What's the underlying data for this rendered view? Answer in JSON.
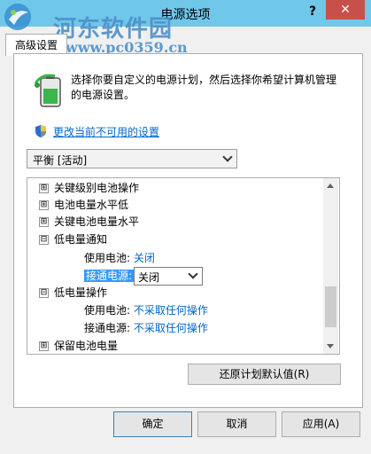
{
  "window": {
    "title": "电源选项",
    "help_label": "?",
    "close_label": "✕"
  },
  "watermark": {
    "title": "河东软件园",
    "url": "www.pc0359.cn"
  },
  "tab": {
    "label": "高级设置"
  },
  "description": "选择你要自定义的电源计划，然后选择你希望计算机管理的电源设置。",
  "change_link": "更改当前不可用的设置",
  "plan_select": {
    "value": "平衡 [活动]"
  },
  "tree": {
    "items": [
      {
        "expander": "⊞",
        "label": "关键级别电池操作"
      },
      {
        "expander": "⊞",
        "label": "电池电量水平低"
      },
      {
        "expander": "⊞",
        "label": "关键电池电量水平"
      },
      {
        "expander": "⊟",
        "label": "低电量通知"
      },
      {
        "label": "使用电池:",
        "value": "关闭"
      },
      {
        "label": "接通电源:",
        "value": "关闭"
      },
      {
        "expander": "⊟",
        "label": "低电量操作"
      },
      {
        "label": "使用电池:",
        "value": "不采取任何操作"
      },
      {
        "label": "接通电源:",
        "value": "不采取任何操作"
      },
      {
        "expander": "⊞",
        "label": "保留电池电量"
      }
    ]
  },
  "buttons": {
    "restore": "还原计划默认值(R)",
    "ok": "确定",
    "cancel": "取消",
    "apply": "应用(A)"
  },
  "colors": {
    "titlebar": "#6fc7e9",
    "close": "#c7504b",
    "link": "#0066cc",
    "selection": "#3399ff"
  }
}
